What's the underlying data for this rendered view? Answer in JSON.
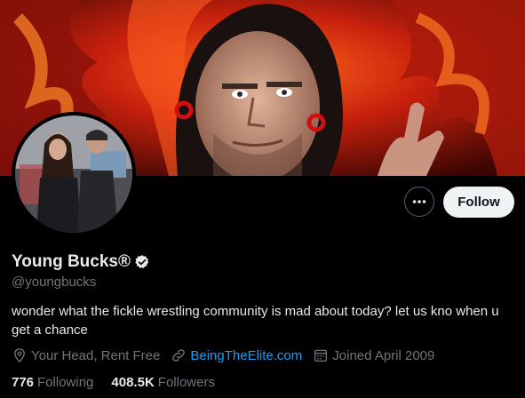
{
  "profile": {
    "display_name": "Young Bucks®",
    "handle": "@youngbucks",
    "bio": "wonder what the fickle wrestling community is mad about today? let us kno when u get a chance",
    "location": "Your Head, Rent Free",
    "website": "BeingTheElite.com",
    "joined": "Joined April 2009",
    "following_count": "776",
    "following_label": "Following",
    "followers_count": "408.5K",
    "followers_label": "Followers"
  },
  "actions": {
    "follow_label": "Follow",
    "more_icon": "more-horizontal-icon"
  },
  "colors": {
    "background": "#000000",
    "link": "#1d9bf0",
    "secondary_text": "#71767b",
    "follow_button_bg": "#eff3f4"
  },
  "icons": {
    "verified": "verified-badge-icon",
    "location": "location-pin-icon",
    "link": "link-icon",
    "calendar": "calendar-icon"
  }
}
